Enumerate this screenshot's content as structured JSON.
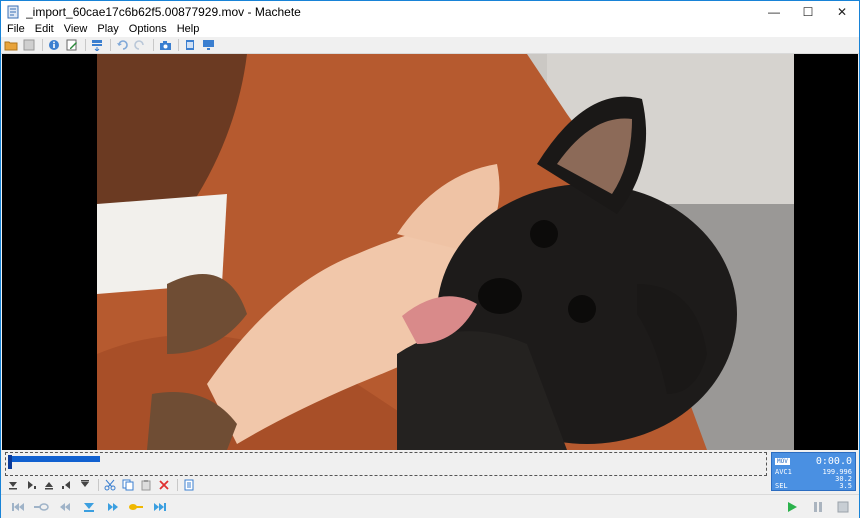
{
  "window": {
    "title": "_import_60cae17c6b62f5.00877929.mov - Machete",
    "controls": {
      "minimize": "—",
      "maximize": "☐",
      "close": "✕"
    }
  },
  "menu": [
    "File",
    "Edit",
    "View",
    "Play",
    "Options",
    "Help"
  ],
  "toolbar_icons": [
    "open-folder-icon",
    "save-icon",
    "info-icon",
    "edit-tags-icon",
    "batch-icon",
    "undo-icon",
    "redo-icon",
    "snapshot-icon",
    "frame-view-icon",
    "monitor-icon"
  ],
  "edit_icons": [
    "mark-in-icon",
    "mark-out-icon",
    "clear-marks-icon",
    "go-in-icon",
    "go-out-icon",
    "cut-icon",
    "copy-icon",
    "paste-icon",
    "delete-icon",
    "properties-icon"
  ],
  "lcd": {
    "format": "MOV",
    "time": "0:00.0",
    "codec_label": "AVC1",
    "codec_value": "199.996",
    "line2_value": "30.2",
    "sel_label": "SEL",
    "sel_value": "3.5"
  },
  "colors": {
    "accent": "#1883d7",
    "lcd_bg": "#4a90e2",
    "selection": "#1060d0"
  }
}
